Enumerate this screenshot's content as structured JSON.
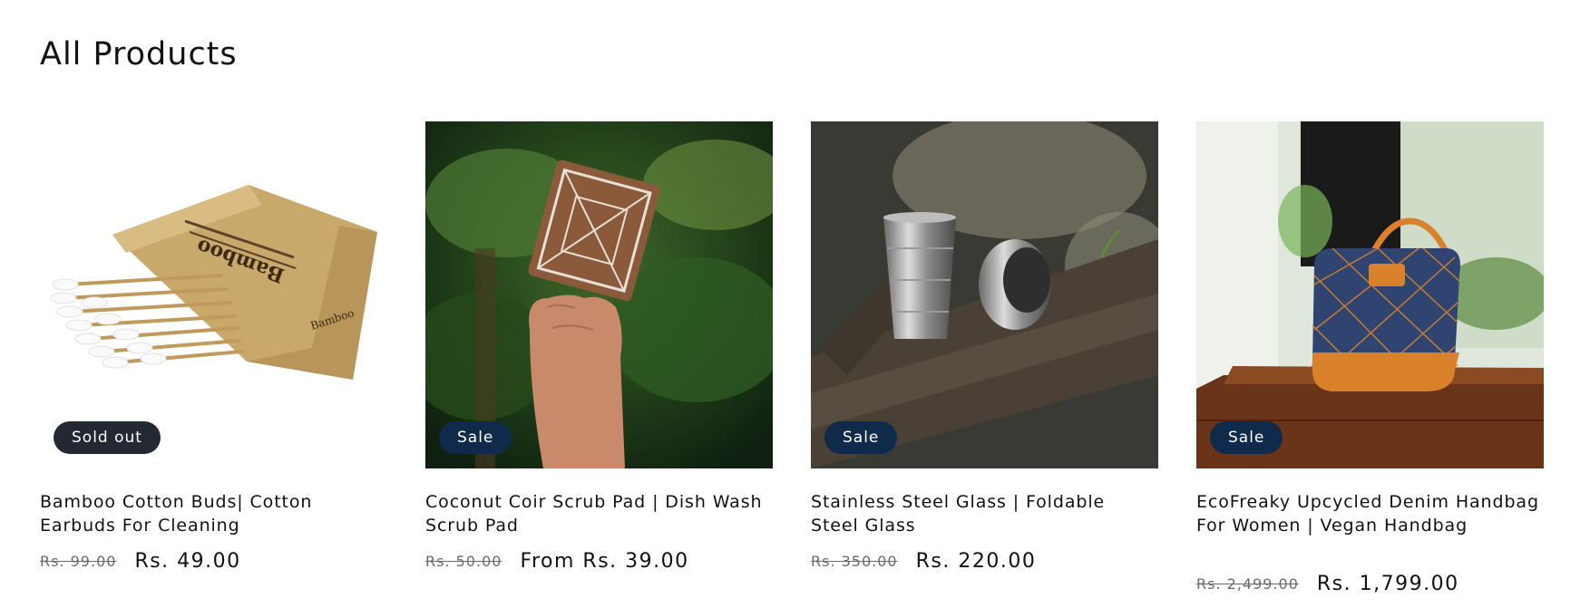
{
  "section": {
    "title": "All Products"
  },
  "products": [
    {
      "badge": "Sold out",
      "title": "Bamboo Cotton Buds| Cotton Earbuds For Cleaning",
      "regular_price": "Rs. 99.00",
      "sale_price": "Rs. 49.00",
      "image_icon": "bamboo-cotton-buds-box-image",
      "package_text": "Bamboo"
    },
    {
      "badge": "Sale",
      "title": "Coconut Coir Scrub Pad | Dish Wash Scrub Pad",
      "regular_price": "Rs. 50.00",
      "sale_price": "From Rs. 39.00",
      "image_icon": "coconut-coir-scrub-pad-image"
    },
    {
      "badge": "Sale",
      "title": "Stainless Steel Glass | Foldable Steel Glass",
      "regular_price": "Rs. 350.00",
      "sale_price": "Rs. 220.00",
      "image_icon": "foldable-steel-glass-image"
    },
    {
      "badge": "Sale",
      "title": "EcoFreaky Upcycled Denim Handbag For Women | Vegan Handbag",
      "regular_price": "Rs. 2,499.00",
      "sale_price": "Rs. 1,799.00",
      "image_icon": "denim-handbag-image"
    }
  ],
  "colors": {
    "text": "#121212",
    "muted": "#6b6b6b",
    "sold_badge": "#242833",
    "sale_badge": "#0f2a4a",
    "background": "#ffffff"
  }
}
